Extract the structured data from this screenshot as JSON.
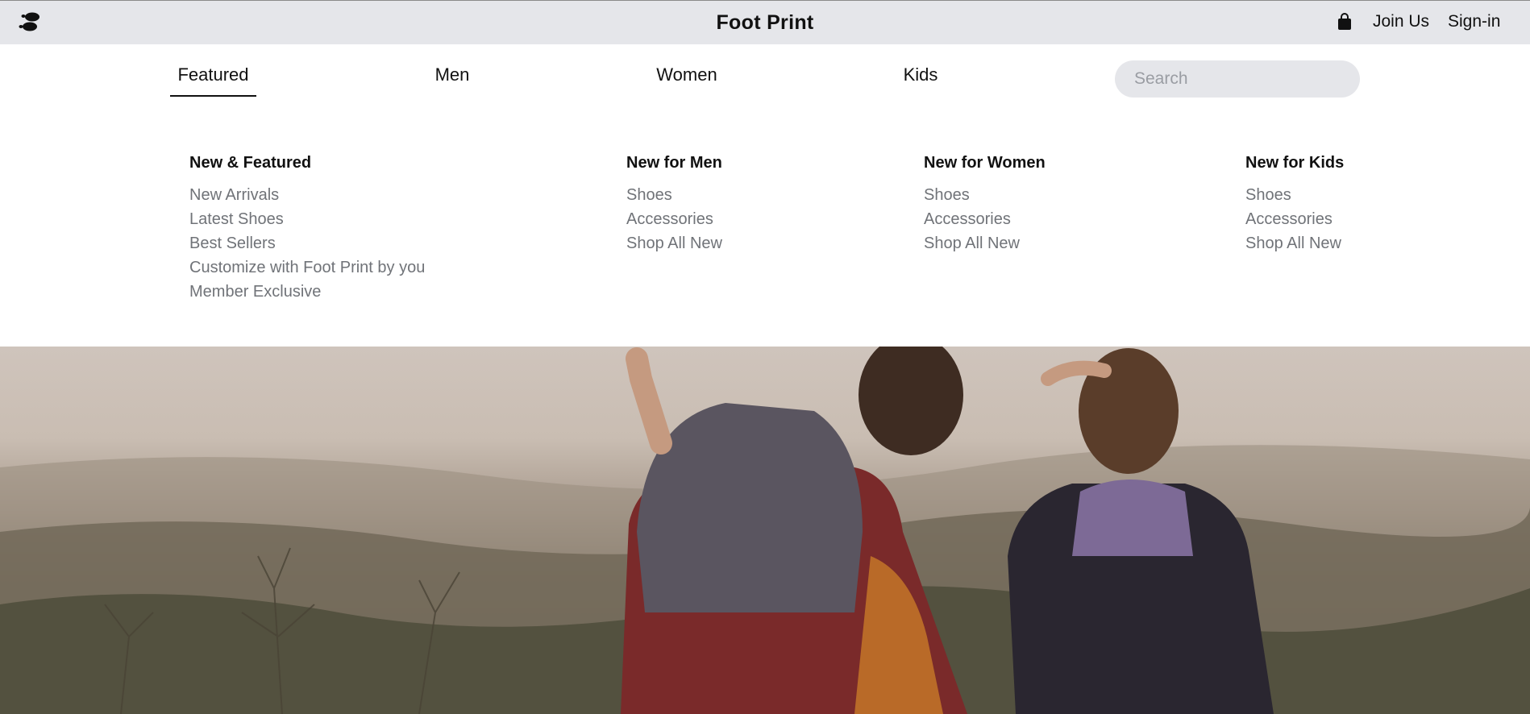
{
  "header": {
    "brand": "Foot Print",
    "logo_icon": "footprints-icon",
    "cart_icon": "shopping-bag-icon",
    "join_label": "Join Us",
    "signin_label": "Sign-in",
    "background_color": "#e5e6ea"
  },
  "nav": {
    "tabs": [
      {
        "label": "Featured",
        "active": true
      },
      {
        "label": "Men",
        "active": false
      },
      {
        "label": "Women",
        "active": false
      },
      {
        "label": "Kids",
        "active": false
      }
    ]
  },
  "search": {
    "placeholder": "Search",
    "value": ""
  },
  "menu": {
    "columns": [
      {
        "title": "New & Featured",
        "links": [
          "New Arrivals",
          "Latest Shoes",
          "Best Sellers",
          "Customize with Foot Print by you",
          "Member Exclusive"
        ]
      },
      {
        "title": "New for Men",
        "links": [
          "Shoes",
          "Accessories",
          "Shop All New"
        ]
      },
      {
        "title": "New for Women",
        "links": [
          "Shoes",
          "Accessories",
          "Shop All New"
        ]
      },
      {
        "title": "New for Kids",
        "links": [
          "Shoes",
          "Accessories",
          "Shop All New"
        ]
      }
    ]
  },
  "hero": {
    "image": "hikers-overlooking-valley-photo"
  }
}
